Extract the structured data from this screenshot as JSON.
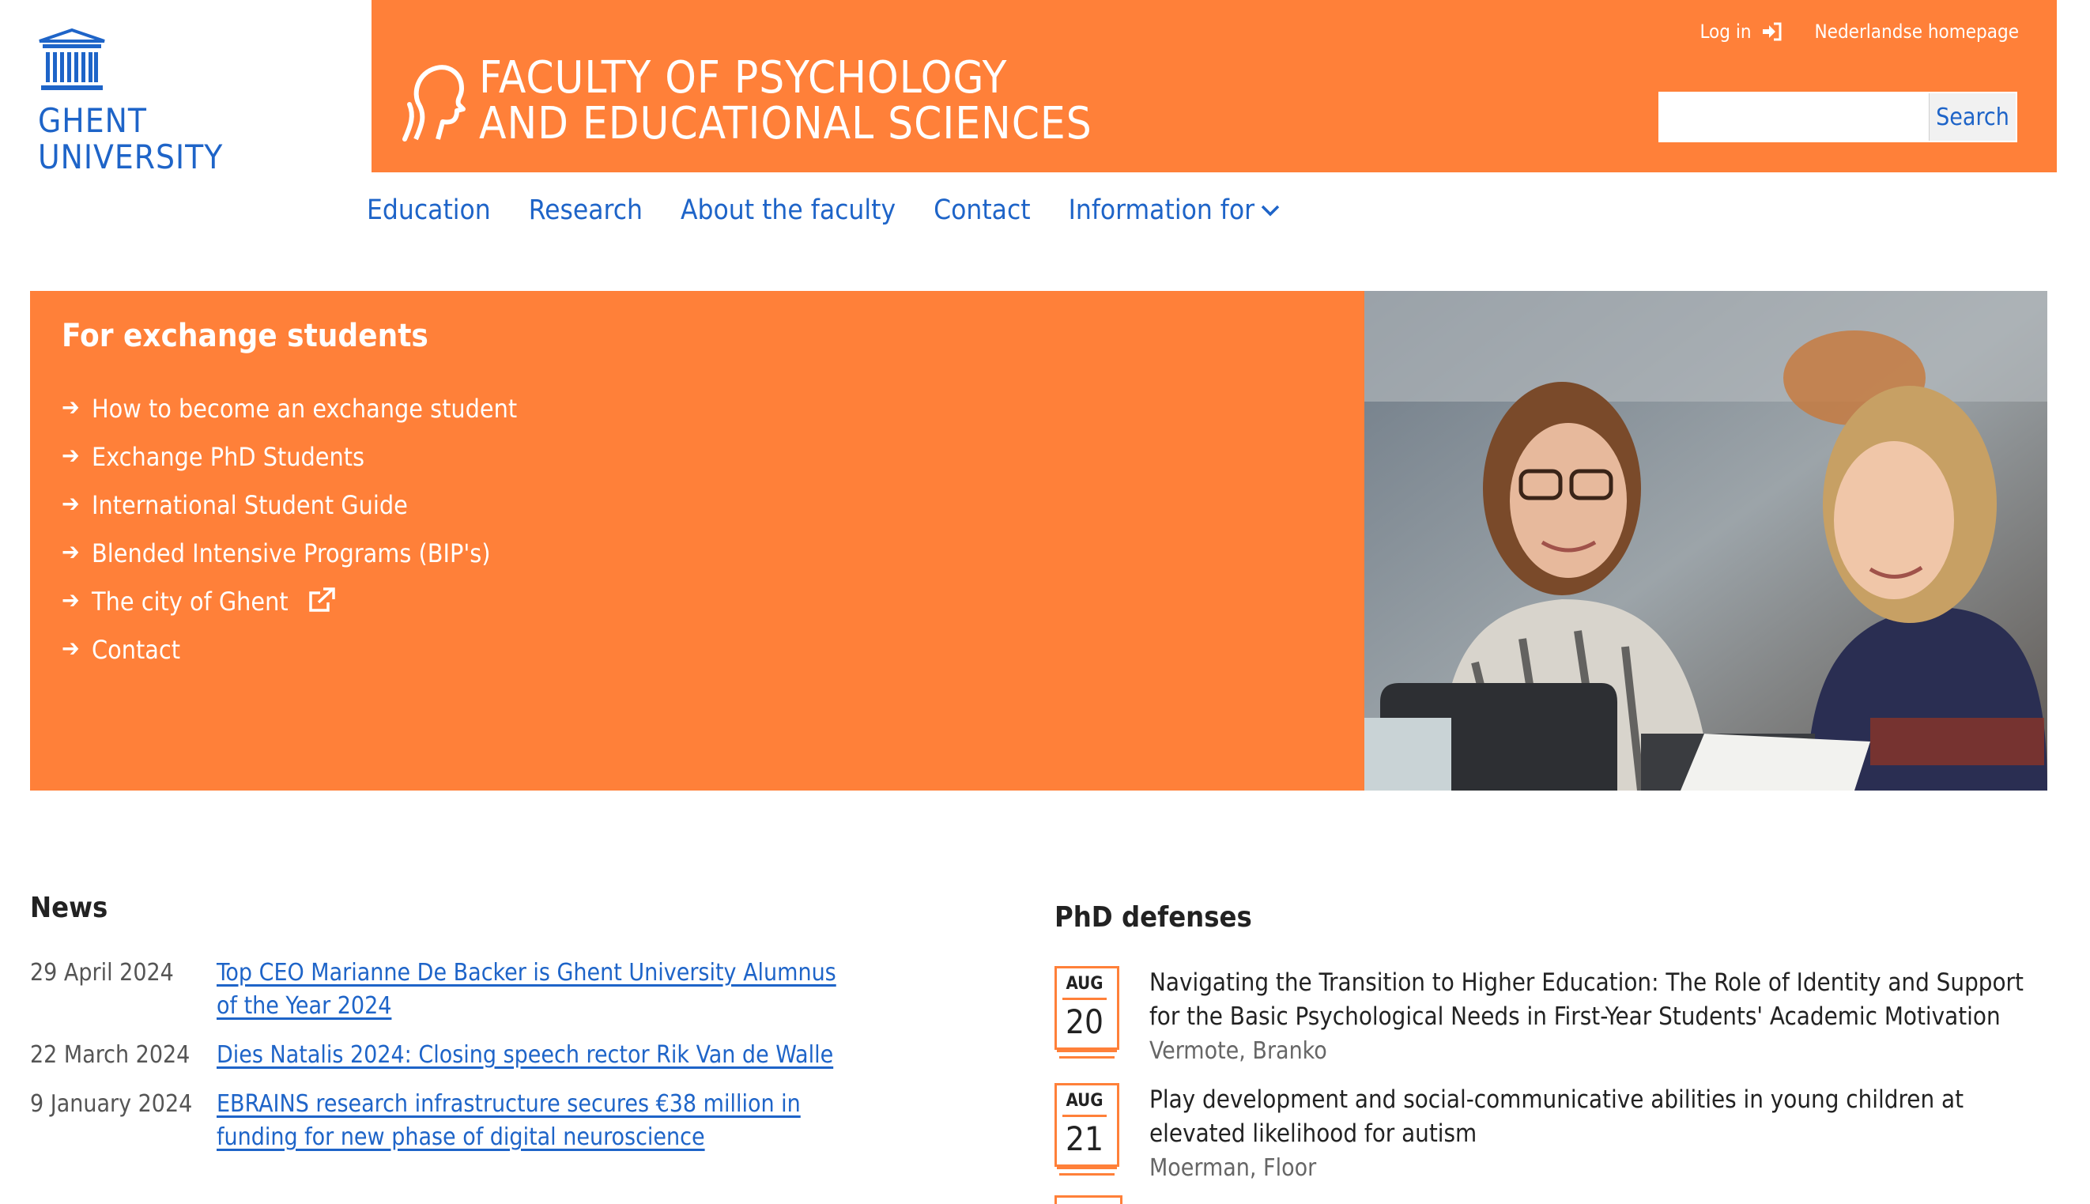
{
  "university": {
    "line1": "GHENT",
    "line2": "UNIVERSITY"
  },
  "faculty": {
    "line1": "FACULTY OF PSYCHOLOGY",
    "line2": "AND EDUCATIONAL SCIENCES"
  },
  "toplinks": {
    "login": "Log in",
    "dutch": "Nederlandse homepage"
  },
  "search": {
    "button": "Search",
    "value": ""
  },
  "nav": [
    "Education",
    "Research",
    "About the faculty",
    "Contact",
    "Information for"
  ],
  "hero": {
    "title": "For exchange students",
    "links": [
      "How to become an exchange student",
      "Exchange PhD Students",
      "International Student Guide",
      "Blended Intensive Programs (BIP's)",
      "The city of Ghent",
      "Contact"
    ]
  },
  "news": {
    "title": "News",
    "items": [
      {
        "date": "29 April 2024",
        "title": "Top CEO Marianne De Backer is Ghent University Alumnus of the Year 2024"
      },
      {
        "date": "22 March 2024",
        "title": "Dies Natalis 2024: Closing speech rector Rik Van de Walle"
      },
      {
        "date": "9 January 2024",
        "title": "EBRAINS research infrastructure secures €38 million in funding for new phase of digital neuroscience"
      }
    ]
  },
  "phd": {
    "title": "PhD defenses",
    "items": [
      {
        "month": "AUG",
        "day": "20",
        "title": "Navigating the Transition to Higher Education: The Role of Identity and Support for the Basic Psychological Needs in First-Year Students' Academic Motivation",
        "author": "Vermote, Branko"
      },
      {
        "month": "AUG",
        "day": "21",
        "title": "Play development and social-communicative abilities in young children at elevated likelihood for autism",
        "author": "Moerman, Floor"
      }
    ]
  },
  "colors": {
    "brand_orange": "#ff8039",
    "ugent_blue": "#1e64c8"
  }
}
